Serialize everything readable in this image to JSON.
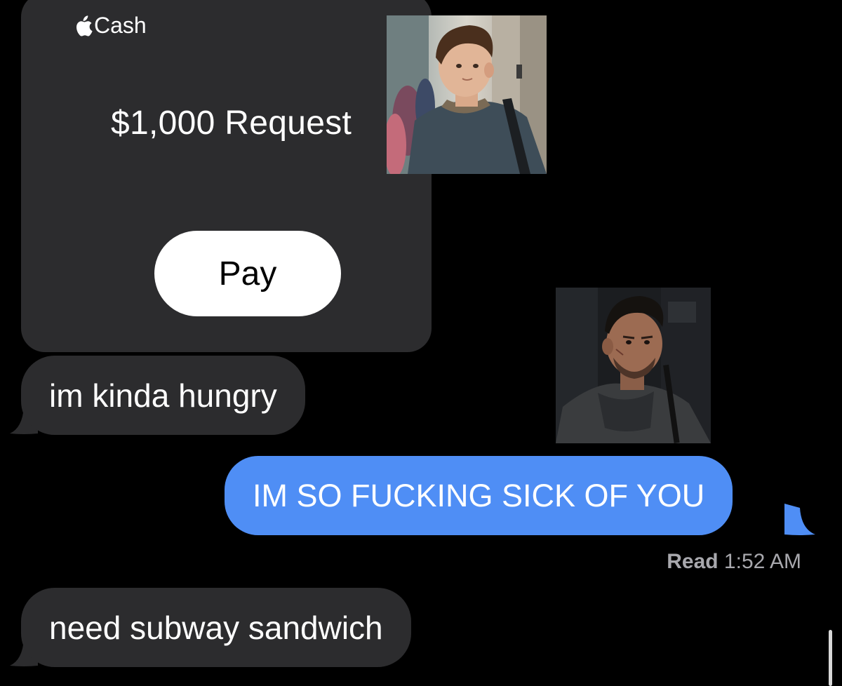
{
  "cash_card": {
    "brand": "Cash",
    "amount_text": "$1,000 Request",
    "pay_label": "Pay"
  },
  "messages": [
    {
      "direction": "received",
      "text": "im kinda hungry"
    },
    {
      "direction": "sent",
      "text": "IM SO FUCKING SICK OF YOU"
    },
    {
      "direction": "received",
      "text": "need subway sandwich"
    }
  ],
  "read_receipt": {
    "label": "Read",
    "time": "1:52 AM"
  },
  "colors": {
    "background": "#000000",
    "received_bubble": "#2c2c2e",
    "sent_bubble": "#4f8ef5",
    "pay_button": "#ffffff"
  },
  "icons": {
    "brand_icon": "apple-logo-icon"
  }
}
